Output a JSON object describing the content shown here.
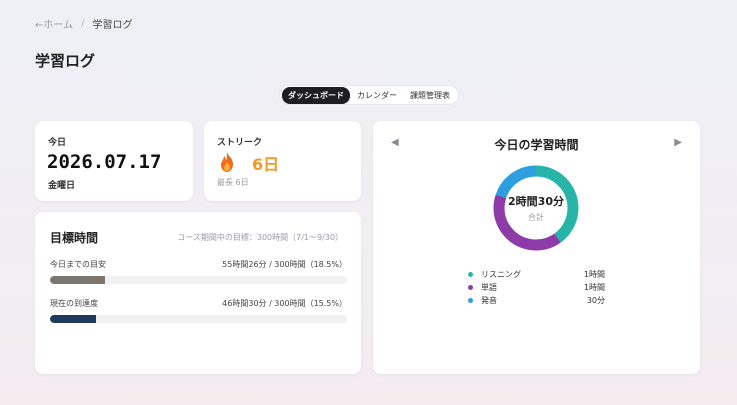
{
  "breadcrumb": {
    "home": "←ホーム",
    "separator": "/",
    "current": "学習ログ"
  },
  "page_title": "学習ログ",
  "tabs": [
    {
      "label": "ダッシュボード",
      "active": true
    },
    {
      "label": "カレンダー",
      "active": false
    },
    {
      "label": "課題管理表",
      "active": false
    }
  ],
  "today_card": {
    "label": "今日",
    "date": "2026.07.17",
    "weekday": "金曜日"
  },
  "streak_card": {
    "label": "ストリーク",
    "icon": "flame-icon",
    "days": "6日",
    "best": "最長 6日",
    "accent": "#f29a1f"
  },
  "goal_card": {
    "title": "目標時間",
    "period": "コース期間中の目標：300時間（7/1〜9/30）",
    "rows": [
      {
        "label": "今日までの目安",
        "value": "55時間26分 / 300時間（18.5%）",
        "percent": 18.5,
        "color": "#7b776f"
      },
      {
        "label": "現在の到達度",
        "value": "46時間30分 / 300時間（15.5%）",
        "percent": 15.5,
        "color": "#1f3a5c"
      }
    ]
  },
  "study_card": {
    "title": "今日の学習時間",
    "prev": "◀",
    "next": "▶",
    "total": "2時間30分",
    "total_label": "合計",
    "segments": [
      {
        "name": "リスニング",
        "value": "1時間",
        "minutes": 60,
        "color": "#26b5a8"
      },
      {
        "name": "単語",
        "value": "1時間",
        "minutes": 60,
        "color": "#8e3aa8"
      },
      {
        "name": "発音",
        "value": "30分",
        "minutes": 30,
        "color": "#2d9ee0"
      }
    ]
  }
}
